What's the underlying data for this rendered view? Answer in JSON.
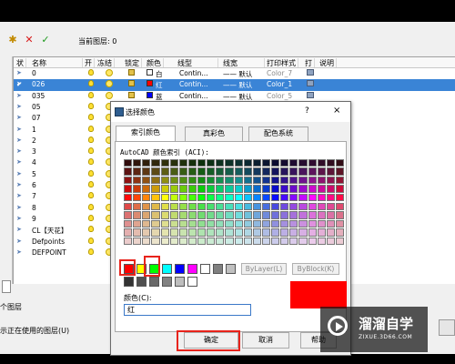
{
  "toolbar": {
    "current_layer_label": "当前图层: 0"
  },
  "list": {
    "headers": [
      "状",
      "名称",
      "开",
      "冻结",
      "锁定",
      "颜色",
      "线型",
      "线宽",
      "打印样式",
      "打",
      "说明"
    ],
    "rows": [
      {
        "name": "0",
        "color": "白",
        "color_hex": "#ffffff",
        "linetype": "Contin...",
        "lineweight": "—— 默认",
        "plot_style": "Color_7",
        "selected": false
      },
      {
        "name": "026",
        "color": "红",
        "color_hex": "#ff0000",
        "linetype": "Contin...",
        "lineweight": "—— 默认",
        "plot_style": "Color_1",
        "selected": true
      },
      {
        "name": "035",
        "color": "蓝",
        "color_hex": "#0000ff",
        "linetype": "Contin...",
        "lineweight": "—— 默认",
        "plot_style": "Color_5",
        "selected": false
      },
      {
        "name": "05"
      },
      {
        "name": "07"
      },
      {
        "name": "1"
      },
      {
        "name": "2"
      },
      {
        "name": "3"
      },
      {
        "name": "4"
      },
      {
        "name": "5"
      },
      {
        "name": "6"
      },
      {
        "name": "7"
      },
      {
        "name": "8"
      },
      {
        "name": "9"
      },
      {
        "name": "CL【天花】"
      },
      {
        "name": "Defpoints"
      },
      {
        "name": "DEFPOINT"
      }
    ]
  },
  "status": {
    "line1": "个图层",
    "line2": "示正在使用的图层(U)"
  },
  "dialog": {
    "title": "选择颜色",
    "help": "?",
    "close": "×",
    "tabs": [
      "索引颜色",
      "真彩色",
      "配色系统"
    ],
    "aci_label": "AutoCAD 颜色索引 (ACI):",
    "bylayer": "ByLayer(L)",
    "byblock": "ByBlock(K)",
    "color_label": "颜色(C):",
    "color_value": "红",
    "preview_color": "#ff0000",
    "ok": "确定",
    "cancel": "取消",
    "help_btn": "帮助"
  },
  "watermark": {
    "main": "溜溜自学",
    "sub": "ZIXUE.3D66.COM"
  }
}
